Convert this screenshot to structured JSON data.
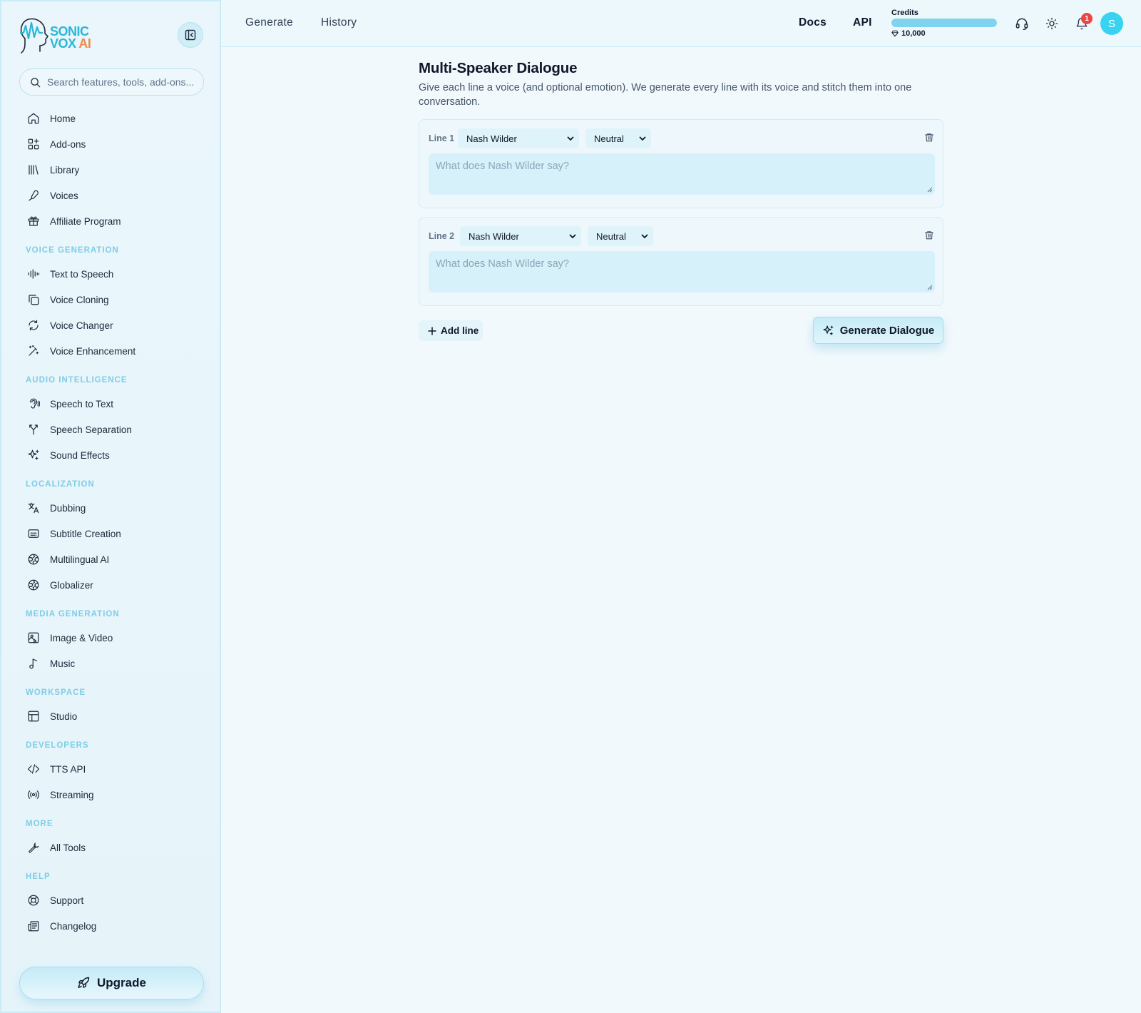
{
  "brand": {
    "line1": "SONIC",
    "line2": "VOX",
    "line2_accent": "AI"
  },
  "search": {
    "placeholder": "Search features, tools, add-ons..."
  },
  "nav_main": [
    {
      "label": "Home",
      "icon": "home-icon"
    },
    {
      "label": "Add-ons",
      "icon": "addons-icon"
    },
    {
      "label": "Library",
      "icon": "library-icon"
    },
    {
      "label": "Voices",
      "icon": "microphone-icon"
    },
    {
      "label": "Affiliate Program",
      "icon": "gift-icon"
    }
  ],
  "sections": [
    {
      "title": "VOICE GENERATION",
      "items": [
        {
          "label": "Text to Speech",
          "icon": "waveform-icon"
        },
        {
          "label": "Voice Cloning",
          "icon": "copy-icon"
        },
        {
          "label": "Voice Changer",
          "icon": "refresh-icon"
        },
        {
          "label": "Voice Enhancement",
          "icon": "magic-wand-icon"
        }
      ]
    },
    {
      "title": "AUDIO INTELLIGENCE",
      "items": [
        {
          "label": "Speech to Text",
          "icon": "ear-icon"
        },
        {
          "label": "Speech Separation",
          "icon": "split-icon"
        },
        {
          "label": "Sound Effects",
          "icon": "sparkles-icon"
        }
      ]
    },
    {
      "title": "LOCALIZATION",
      "items": [
        {
          "label": "Dubbing",
          "icon": "translate-icon"
        },
        {
          "label": "Subtitle Creation",
          "icon": "captions-icon"
        },
        {
          "label": "Multilingual AI",
          "icon": "globe-icon"
        },
        {
          "label": "Globalizer",
          "icon": "globe-icon"
        }
      ]
    },
    {
      "title": "MEDIA GENERATION",
      "items": [
        {
          "label": "Image & Video",
          "icon": "image-video-icon"
        },
        {
          "label": "Music",
          "icon": "music-note-icon"
        }
      ]
    },
    {
      "title": "WORKSPACE",
      "items": [
        {
          "label": "Studio",
          "icon": "layout-icon"
        }
      ]
    },
    {
      "title": "DEVELOPERS",
      "items": [
        {
          "label": "TTS API",
          "icon": "code-icon"
        },
        {
          "label": "Streaming",
          "icon": "broadcast-icon"
        }
      ]
    },
    {
      "title": "MORE",
      "items": [
        {
          "label": "All Tools",
          "icon": "wrench-icon"
        }
      ]
    },
    {
      "title": "HELP",
      "items": [
        {
          "label": "Support",
          "icon": "lifebuoy-icon"
        },
        {
          "label": "Changelog",
          "icon": "newspaper-icon"
        }
      ]
    }
  ],
  "upgrade_label": "Upgrade",
  "header": {
    "tabs": [
      "Generate",
      "History"
    ],
    "links": [
      "Docs",
      "API"
    ],
    "credits_label": "Credits",
    "credits_value": "10,000",
    "credits_fill_percent": 100,
    "notification_count": "1",
    "avatar_initial": "S"
  },
  "main": {
    "title": "Multi-Speaker Dialogue",
    "description": "Give each line a voice (and optional emotion). We generate every line with its voice and stitch them into one conversation.",
    "lines": [
      {
        "label": "Line 1",
        "voice": "Nash Wilder",
        "emotion": "Neutral",
        "placeholder": "What does Nash Wilder say?"
      },
      {
        "label": "Line 2",
        "voice": "Nash Wilder",
        "emotion": "Neutral",
        "placeholder": "What does Nash Wilder say?"
      }
    ],
    "add_line_label": "Add line",
    "generate_label": "Generate Dialogue"
  },
  "colors": {
    "accent": "#29b6d8",
    "accent_orange": "#f08a4b",
    "avatar": "#38d3f0",
    "badge": "#ef4444",
    "section_label": "#7fcde6"
  }
}
